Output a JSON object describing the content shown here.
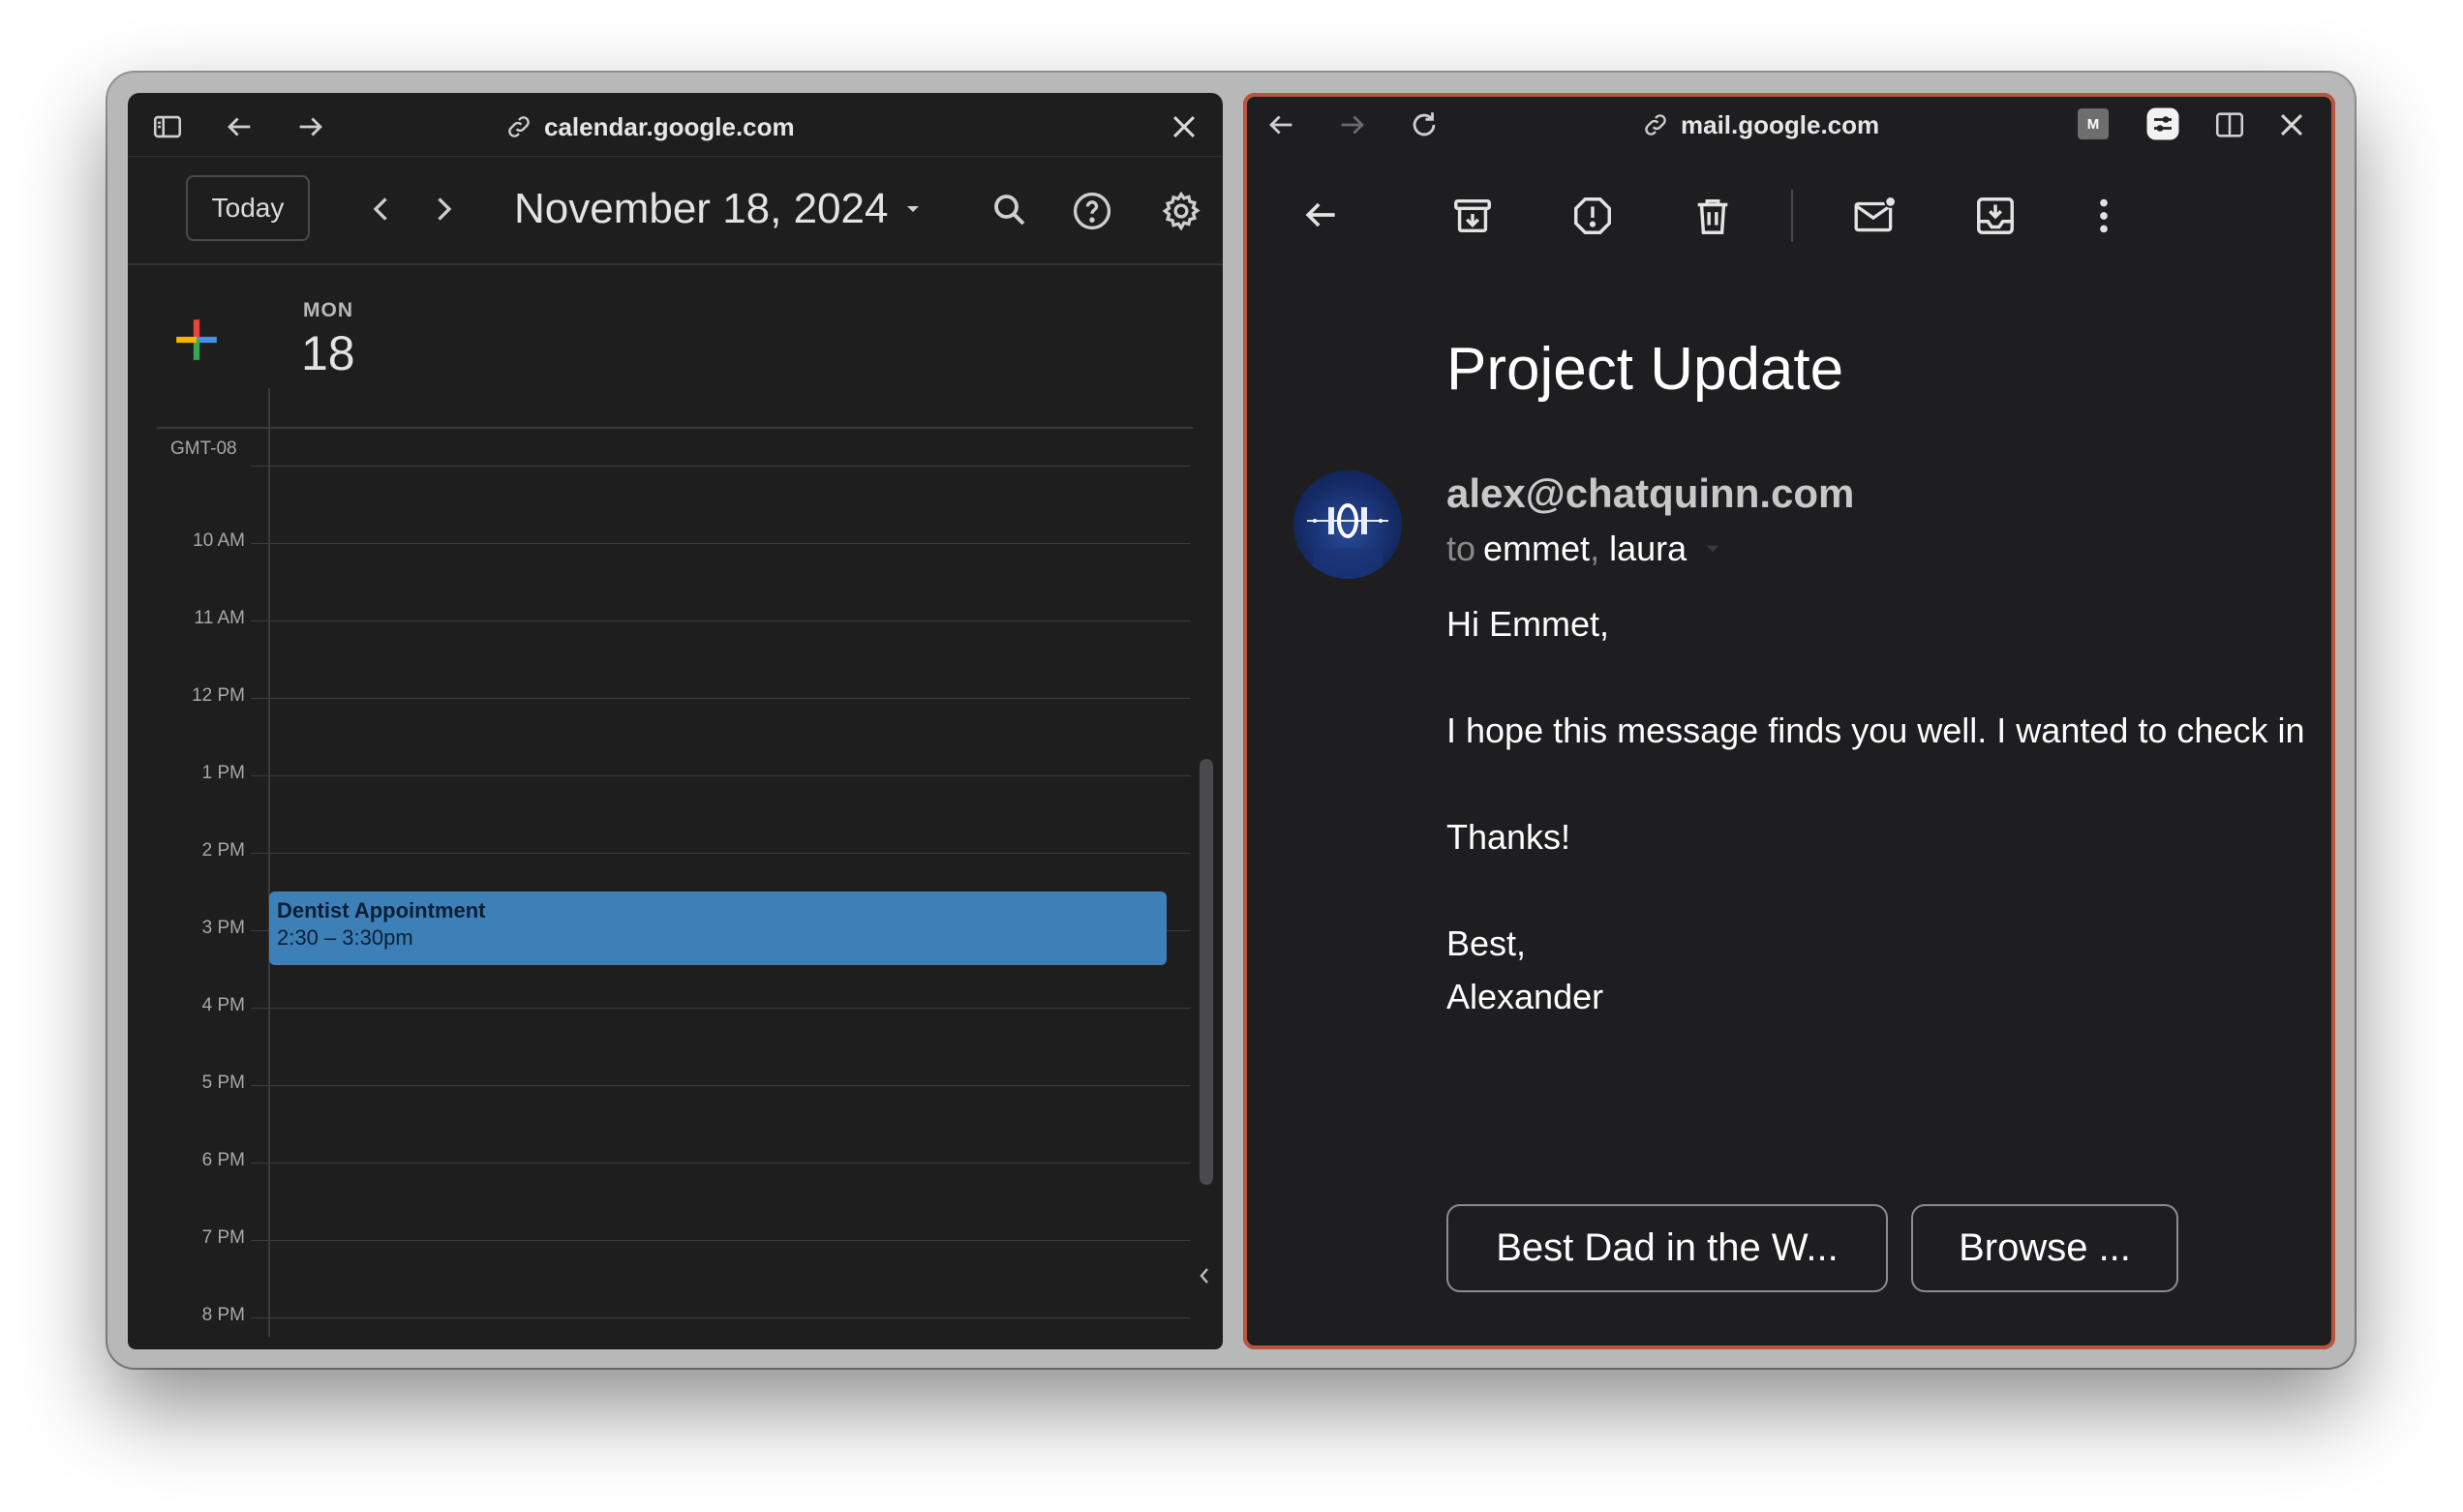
{
  "calendar": {
    "url": "calendar.google.com",
    "today_button": "Today",
    "date_title": "November 18, 2024",
    "day_name": "MON",
    "day_number": "18",
    "timezone": "GMT-08",
    "hours": [
      "10 AM",
      "11 AM",
      "12 PM",
      "1 PM",
      "2 PM",
      "3 PM",
      "4 PM",
      "5 PM",
      "6 PM",
      "7 PM",
      "8 PM"
    ],
    "event": {
      "title": "Dentist Appointment",
      "time": "2:30 – 3:30pm",
      "color": "#3d80b8"
    },
    "icons": [
      "sidebar-icon",
      "back-arrow-icon",
      "forward-arrow-icon",
      "link-icon",
      "close-icon",
      "chevron-left-icon",
      "chevron-right-icon",
      "caret-down-icon",
      "search-icon",
      "help-icon",
      "settings-icon",
      "plus-icon"
    ]
  },
  "mail": {
    "url": "mail.google.com",
    "extension_label": "M",
    "subject": "Project Update",
    "sender": "alex@chatquinn.com",
    "to_prefix": "to",
    "recipient_1": "emmet",
    "recipient_separator": ",",
    "recipient_2": "laura",
    "greeting": "Hi Emmet,",
    "paragraph": "I hope this message finds you well. I wanted to check in",
    "thanks": "Thanks!",
    "signoff": "Best,",
    "signature": "Alexander",
    "smart_reply_1": "Best Dad in the W...",
    "smart_reply_2": "Browse ...",
    "icons": [
      "back-arrow-icon",
      "forward-arrow-icon",
      "reload-icon",
      "link-icon",
      "extension-icon",
      "split-view-icon",
      "close-icon",
      "archive-icon",
      "spam-icon",
      "delete-icon",
      "mark-unread-icon",
      "move-to-icon",
      "more-vert-icon",
      "avatar"
    ]
  }
}
